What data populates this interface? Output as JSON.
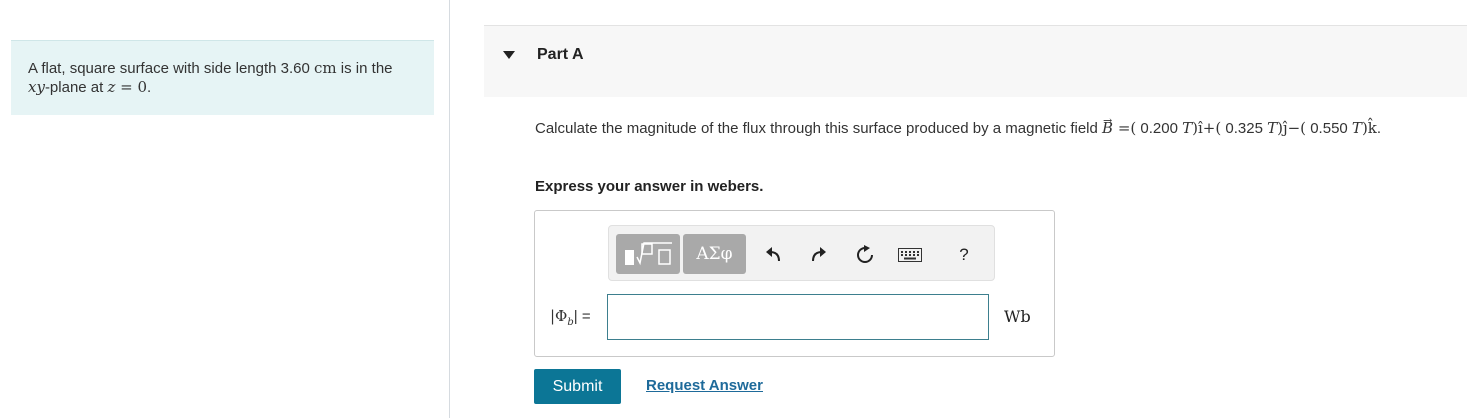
{
  "problem": {
    "text_1": "A flat, square surface with side length 3.60 ",
    "unit_cm": "cm",
    "text_2": " is in the ",
    "plane_var": "xy",
    "text_3": "-plane at ",
    "z_var": "z",
    "text_4": " = ",
    "z_val": "0",
    "text_5": "."
  },
  "part": {
    "title": "Part A"
  },
  "question": {
    "lead": "Calculate the magnitude of the flux through this surface produced by a magnetic field ",
    "B": "B",
    "eq": " =(",
    "bx": " 0.200 ",
    "T1": "T",
    "ihat": ")î+(",
    "by": " 0.325 ",
    "T2": "T",
    "jhat": ")ĵ−(",
    "bz": " 0.550 ",
    "T3": "T",
    "khat": ")k̂",
    "end": "."
  },
  "instruction": "Express your answer in webers.",
  "toolbar": {
    "templates_icon": "templates-icon",
    "symbols_label": "ΑΣφ",
    "undo_icon": "undo-icon",
    "redo_icon": "redo-icon",
    "reset_icon": "reset-icon",
    "keyboard_icon": "keyboard-icon",
    "help_label": "?"
  },
  "answer": {
    "label_left": "|Φ",
    "label_sub": "b",
    "label_right": "| =",
    "value": "",
    "unit": "Wb"
  },
  "buttons": {
    "submit": "Submit",
    "request": "Request Answer"
  },
  "colors": {
    "problem_bg": "#e6f4f5",
    "submit_bg": "#0c7696",
    "link": "#1e6a9a",
    "input_border": "#3d7f8e"
  }
}
